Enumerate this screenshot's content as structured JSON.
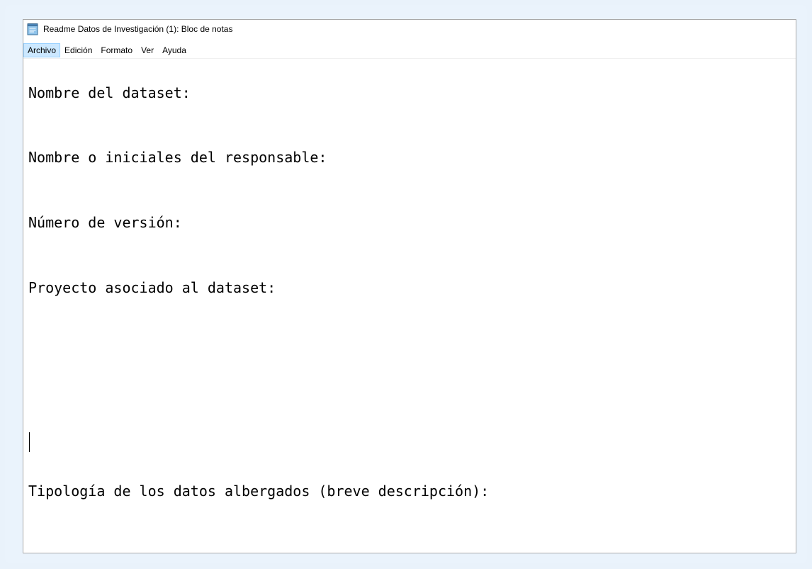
{
  "window": {
    "title": "Readme Datos de Investigación (1): Bloc de notas",
    "app_icon": "notepad-icon"
  },
  "menubar": {
    "items": [
      {
        "label": "Archivo",
        "active": true
      },
      {
        "label": "Edición"
      },
      {
        "label": "Formato"
      },
      {
        "label": "Ver"
      },
      {
        "label": "Ayuda"
      }
    ]
  },
  "editor": {
    "lines": [
      "Nombre del dataset:",
      "Nombre o iniciales del responsable:",
      "Número de versión:",
      "Proyecto asociado al dataset:",
      "Tipología de los datos albergados (breve descripción):"
    ]
  }
}
